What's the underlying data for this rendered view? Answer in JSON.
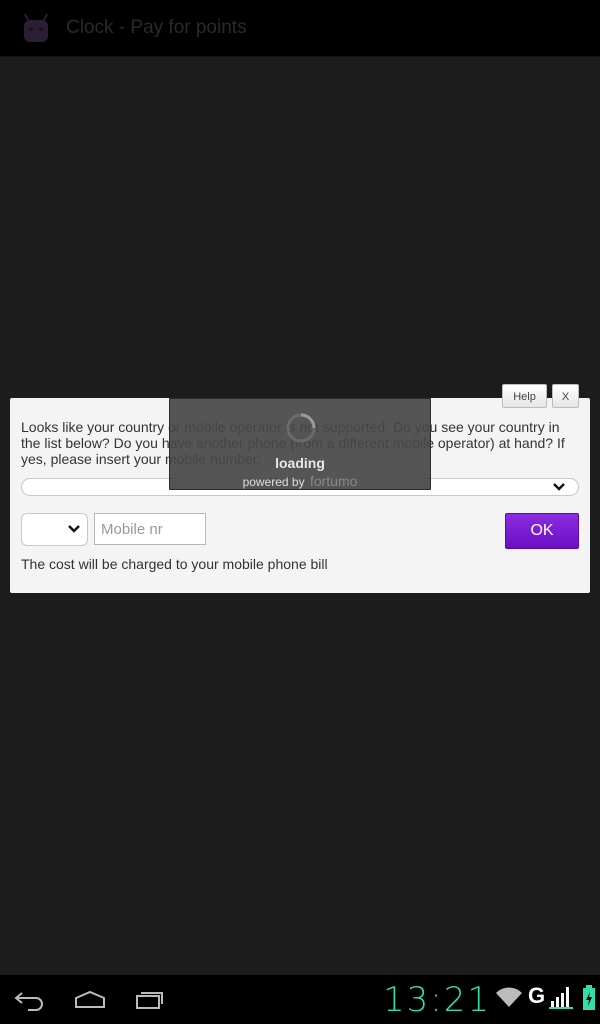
{
  "app": {
    "title": "Clock - Pay for points",
    "icon": "android-robot-icon"
  },
  "dialog": {
    "help_label": "Help",
    "close_label": "X",
    "message": "Looks like your country or mobile operator is not supported. Do you see your country in the list below? Do you have another phone (from a different mobile operator) at hand? If yes, please insert your mobile number:",
    "country_select_value": "",
    "prefix_select_value": "",
    "mobile_placeholder": "Mobile nr",
    "mobile_value": "",
    "ok_label": "OK",
    "cost_note": "The cost will be charged to your mobile phone bill",
    "accent_color": "#7a1fd6"
  },
  "loading": {
    "text": "loading",
    "powered_by": "powered by",
    "brand": "fortumo"
  },
  "statusbar": {
    "time": "13:21",
    "network_type": "G",
    "icons": [
      "back-icon",
      "home-icon",
      "recent-apps-icon",
      "wifi-icon",
      "signal-icon",
      "battery-icon"
    ]
  }
}
